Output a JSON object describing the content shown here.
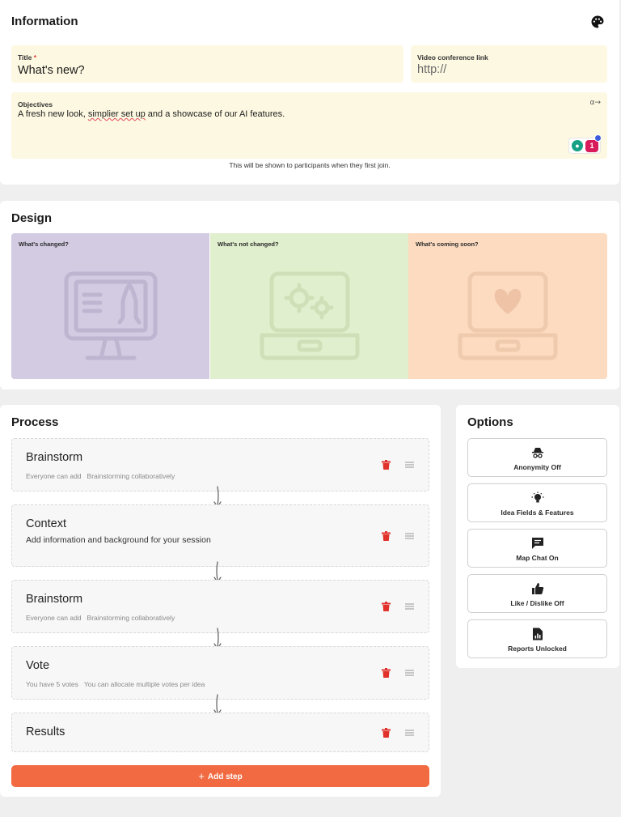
{
  "information": {
    "heading": "Information",
    "title_field": {
      "label": "Title",
      "required_marker": "*",
      "value": "What's new?"
    },
    "video_field": {
      "label": "Video conference link",
      "placeholder": "http://"
    },
    "objectives_field": {
      "label": "Objectives",
      "value_before": "A fresh new look, ",
      "value_misspelled": "simplier set up",
      "value_after": " and a showcase of our AI features."
    },
    "hint": "This will be shown to participants when they first join.",
    "extension_badge_count": "1"
  },
  "design": {
    "heading": "Design",
    "panels": [
      {
        "label": "What's changed?",
        "color": "#d2cbe2"
      },
      {
        "label": "What's not changed?",
        "color": "#e0efcd"
      },
      {
        "label": "What's coming soon?",
        "color": "#fcdbc0"
      }
    ]
  },
  "process": {
    "heading": "Process",
    "steps": [
      {
        "title": "Brainstorm",
        "sub1": "Everyone can add",
        "sub2": "Brainstorming collaboratively"
      },
      {
        "title": "Context",
        "desc": "Add information and background for your session"
      },
      {
        "title": "Brainstorm",
        "sub1": "Everyone can add",
        "sub2": "Brainstorming collaboratively"
      },
      {
        "title": "Vote",
        "sub1": "You have 5 votes",
        "sub2": "You can allocate multiple votes per idea"
      },
      {
        "title": "Results"
      }
    ],
    "add_step_label": "Add step",
    "accent_color": "#f26a41",
    "delete_color": "#e0322b"
  },
  "options": {
    "heading": "Options",
    "items": [
      {
        "label": "Anonymity Off",
        "icon": "incognito-icon"
      },
      {
        "label": "Idea Fields & Features",
        "icon": "lightbulb-icon"
      },
      {
        "label": "Map Chat On",
        "icon": "chat-icon"
      },
      {
        "label": "Like / Dislike Off",
        "icon": "thumbs-up-icon"
      },
      {
        "label": "Reports Unlocked",
        "icon": "report-icon"
      }
    ]
  }
}
